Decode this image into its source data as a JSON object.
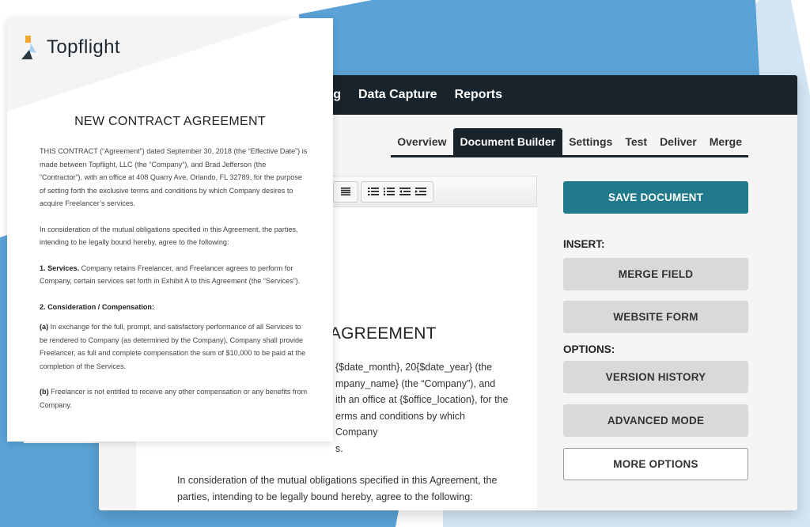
{
  "colors": {
    "bg_blue": "#5ba3d6",
    "bg_light_blue": "#cfe3f3",
    "nav_dark": "#18232b",
    "primary": "#217a8c",
    "button_grey": "#d9d9d9",
    "logo_orange": "#f0a830",
    "logo_light_blue": "#a8d0ee",
    "logo_dark": "#2b3a3f"
  },
  "app": {
    "top_nav": [
      "ing",
      "Data Capture",
      "Reports"
    ],
    "tabs": [
      {
        "label": "Overview",
        "active": false
      },
      {
        "label": "Document Builder",
        "active": true
      },
      {
        "label": "Settings",
        "active": false
      },
      {
        "label": "Test",
        "active": false
      },
      {
        "label": "Deliver",
        "active": false
      },
      {
        "label": "Merge",
        "active": false
      }
    ],
    "toolbar": {
      "icons": [
        "align-justify-icon",
        "bulleted-list-icon",
        "numbered-list-icon",
        "outdent-icon",
        "indent-icon"
      ]
    },
    "editor": {
      "title": "CT AGREEMENT",
      "lines": [
        "{$date_month}, 20{$date_year} (the",
        "mpany_name} (the “Company”), and",
        "ith an office at {$office_location}, for the",
        "erms and conditions by which Company",
        "s."
      ],
      "paragraph2": "In consideration of the mutual obligations specified in this Agreement, the parties, intending to be legally bound hereby, agree to the following:"
    },
    "sidebar": {
      "save_button": "SAVE DOCUMENT",
      "insert_label": "INSERT:",
      "insert_buttons": [
        "MERGE FIELD",
        "WEBSITE FORM"
      ],
      "options_label": "OPTIONS:",
      "option_buttons": [
        "VERSION HISTORY",
        "ADVANCED MODE"
      ],
      "more_button": "MORE OPTIONS"
    }
  },
  "paper": {
    "logo_text": "Topflight",
    "title": "NEW CONTRACT AGREEMENT",
    "p1": "THIS CONTRACT (“Agreement”) dated September 30, 2018 (the “Effective Date”) is made between Topflight, LLC (the “Company”), and Brad Jefferson (the “Contractor”), with an office at 408 Quarry Ave, Orlando, FL 32789, for the purpose of setting forth the exclusive terms and conditions by which Company desires to acquire Freelancer’s services.",
    "p2": "In consideration of the mutual obligations specified in this Agreement, the parties, intending to be legally bound hereby, agree to the following:",
    "s1_heading": "1. Services.",
    "s1_text": " Company retains Freelancer, and Freelancer agrees to perform for Company, certain services set forth in Exhibit A to this Agreement (the “Services”).",
    "s2_heading": "2. Consideration / Compensation:",
    "a_label": "(a)",
    "a_text": " In exchange for the full, prompt, and satisfactory performance of all Services to be rendered to Company (as determined by the Company), Company shall provide Freelancer, as full and complete compensation the sum of $10,000 to be paid at the completion of the Services.",
    "b_label": "(b)",
    "b_text": " Freelancer is not entitled to receive any other compensation or any benefits from Company."
  }
}
